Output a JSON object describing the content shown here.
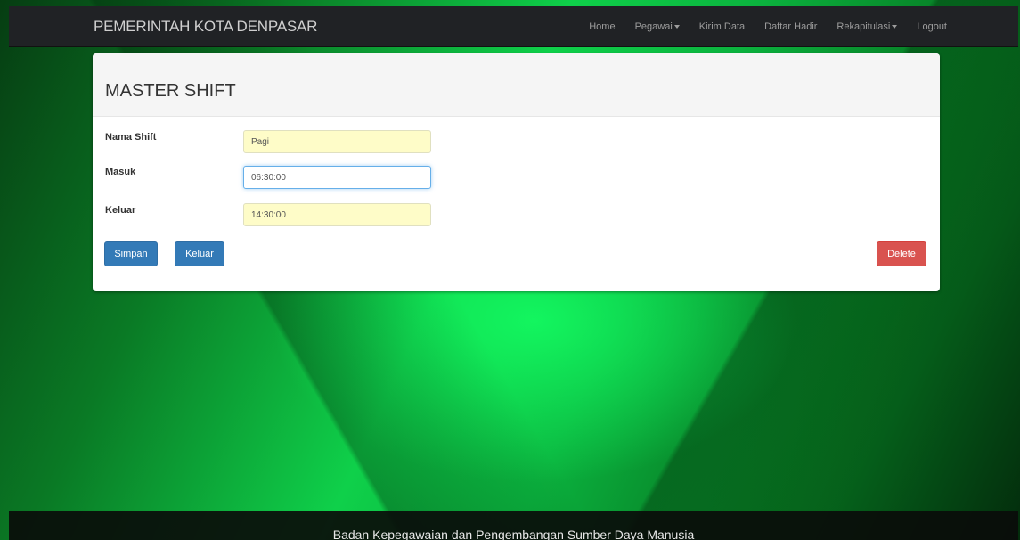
{
  "navbar": {
    "brand": "PEMERINTAH KOTA DENPASAR",
    "items": [
      {
        "label": "Home",
        "dropdown": false
      },
      {
        "label": "Pegawai",
        "dropdown": true
      },
      {
        "label": "Kirim Data",
        "dropdown": false
      },
      {
        "label": "Daftar Hadir",
        "dropdown": false
      },
      {
        "label": "Rekapitulasi",
        "dropdown": true
      },
      {
        "label": "Logout",
        "dropdown": false
      }
    ]
  },
  "panel": {
    "title": "MASTER SHIFT",
    "fields": [
      {
        "label": "Nama Shift",
        "value": "Pagi"
      },
      {
        "label": "Masuk",
        "value": "06:30:00"
      },
      {
        "label": "Keluar",
        "value": "14:30:00"
      }
    ],
    "buttons": {
      "save": "Simpan",
      "exit": "Keluar",
      "delete": "Delete"
    }
  },
  "footer": {
    "text": "Badan Kepegawaian dan Pengembangan Sumber Daya Manusia"
  },
  "colors": {
    "navbar": "#202225",
    "primary": "#337ab7",
    "danger": "#d9534f",
    "input_autofill": "#fefcc8"
  }
}
